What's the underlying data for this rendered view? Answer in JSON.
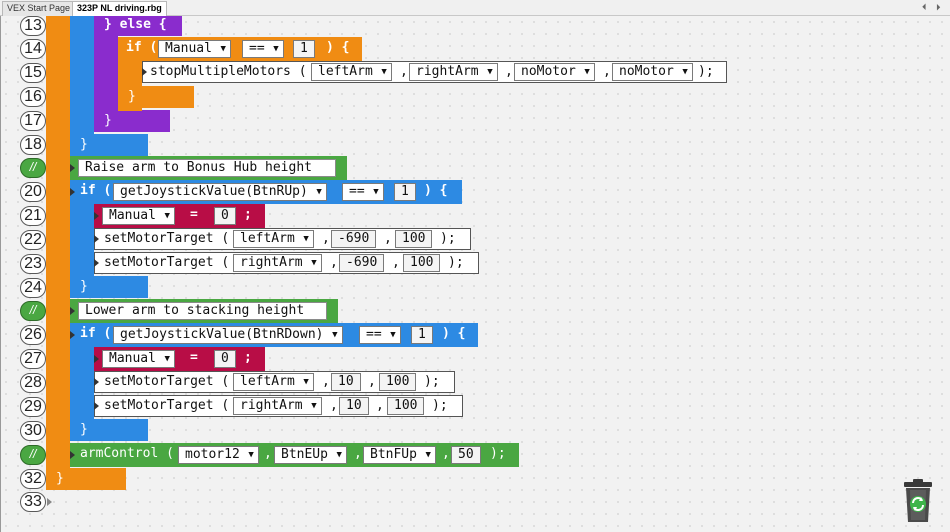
{
  "tabs": [
    {
      "label": "VEX Start Page"
    },
    {
      "label": "323P NL driving.rbg"
    }
  ],
  "nav": {
    "prev": "⏴",
    "next": "⏵"
  },
  "lines": {
    "l13": "13",
    "l14": "14",
    "l15": "15",
    "l16": "16",
    "l17": "17",
    "l18": "18",
    "l19": "//",
    "l20": "20",
    "l21": "21",
    "l22": "22",
    "l23": "23",
    "l24": "24",
    "l25": "//",
    "l26": "26",
    "l27": "27",
    "l28": "28",
    "l29": "29",
    "l30": "30",
    "l31": "//",
    "l32": "32",
    "l33": "33"
  },
  "code": {
    "else_kw": "} else {",
    "if_kw": "if (",
    "if_close": ") {",
    "manual": "Manual",
    "eq_op": "==",
    "one": "1",
    "stop_fn": "stopMultipleMotors (",
    "left_arm": "leftArm",
    "right_arm": "rightArm",
    "no_motor": "noMotor",
    "comma": ",",
    "close_paren": ");",
    "brace": "}",
    "comment_raise": "Raise arm to Bonus Hub height",
    "joy_fn_up": "getJoystickValue(BtnRUp)",
    "assign": "=",
    "zero": "0",
    "semi": ";",
    "set_target": "setMotorTarget (",
    "neg690": "-690",
    "hundred": "100",
    "comment_lower": "Lower arm to stacking height",
    "joy_fn_down": "getJoystickValue(BtnRDown)",
    "ten": "10",
    "arm_fn": "armControl (",
    "motor12": "motor12",
    "btn_eup": "BtnEUp",
    "btn_fup": "BtnFUp",
    "fifty": "50"
  },
  "icons": {
    "dropdown": "▼",
    "trash": "trash-icon"
  },
  "colors": {
    "blue": "#2d8ae3",
    "purple": "#8a2ccd",
    "orange": "#f08c13",
    "red": "#b80d46",
    "green": "#4aa742"
  }
}
